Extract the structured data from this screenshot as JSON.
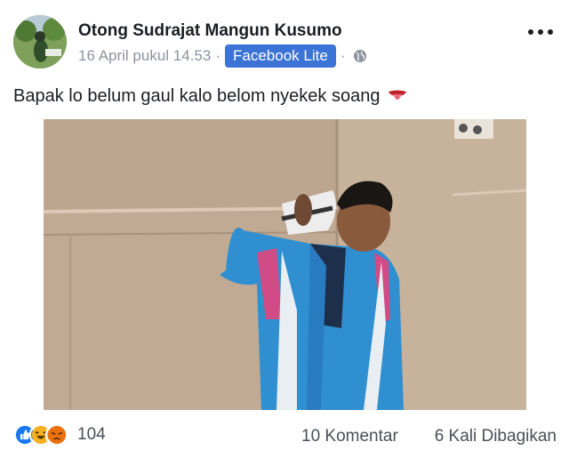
{
  "post": {
    "author": "Otong Sudrajat Mangun Kusumo",
    "timestamp": "16 April pukul 14.53",
    "separator": "·",
    "app_badge": "Facebook Lite",
    "privacy_icon": "globe-icon",
    "more_icon": "more-options-icon",
    "text": "Bapak lo belum gaul kalo belom nyekek soang",
    "text_emoji": "tongue-out-emoji"
  },
  "reactions": {
    "icons": [
      "like-icon",
      "haha-icon",
      "angry-icon"
    ],
    "count": "104"
  },
  "footer": {
    "comments": "10 Komentar",
    "shares": "6 Kali Dibagikan"
  },
  "colors": {
    "badge": "#3b73d6",
    "like": "#1877f2",
    "haha": "#f7b125",
    "angry": "#e9710f"
  }
}
